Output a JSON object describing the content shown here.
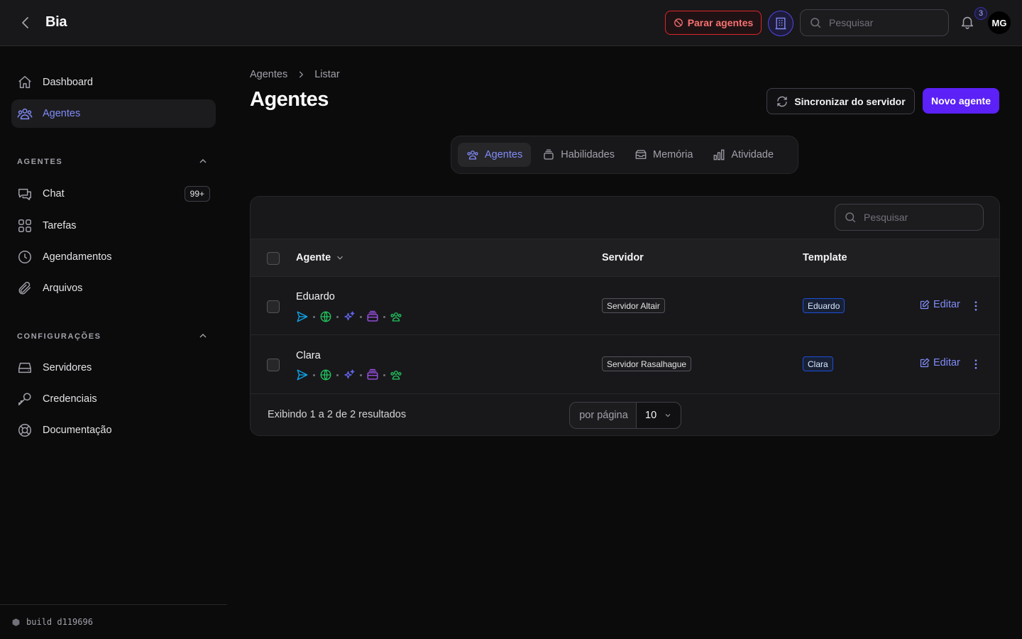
{
  "header": {
    "app_title": "Bia",
    "stop_agents_label": "Parar agentes",
    "search_placeholder": "Pesquisar",
    "notification_count": "3",
    "avatar_initials": "MG"
  },
  "sidebar": {
    "top_items": [
      {
        "label": "Dashboard",
        "icon": "home-icon"
      },
      {
        "label": "Agentes",
        "icon": "users-icon",
        "active": true
      }
    ],
    "sections": [
      {
        "title": "AGENTES",
        "items": [
          {
            "label": "Chat",
            "icon": "chat-icon",
            "badge": "99+"
          },
          {
            "label": "Tarefas",
            "icon": "grid-icon"
          },
          {
            "label": "Agendamentos",
            "icon": "clock-icon"
          },
          {
            "label": "Arquivos",
            "icon": "paperclip-icon"
          }
        ]
      },
      {
        "title": "CONFIGURAÇÕES",
        "items": [
          {
            "label": "Servidores",
            "icon": "server-icon"
          },
          {
            "label": "Credenciais",
            "icon": "key-icon"
          },
          {
            "label": "Documentação",
            "icon": "lifebuoy-icon"
          }
        ]
      }
    ],
    "build": "build d119696"
  },
  "main": {
    "breadcrumb": [
      "Agentes",
      "Listar"
    ],
    "title": "Agentes",
    "sync_label": "Sincronizar do servidor",
    "new_label": "Novo agente",
    "tabs": [
      {
        "label": "Agentes",
        "icon": "users-icon",
        "active": true
      },
      {
        "label": "Habilidades",
        "icon": "stack-icon"
      },
      {
        "label": "Memória",
        "icon": "archive-icon"
      },
      {
        "label": "Atividade",
        "icon": "bar-chart-icon"
      }
    ],
    "table": {
      "search_placeholder": "Pesquisar",
      "columns": [
        "Agente",
        "Servidor",
        "Template"
      ],
      "rows": [
        {
          "name": "Eduardo",
          "server": "Servidor Altair",
          "template": "Eduardo",
          "edit": "Editar"
        },
        {
          "name": "Clara",
          "server": "Servidor Rasalhague",
          "template": "Clara",
          "edit": "Editar"
        }
      ],
      "summary": "Exibindo 1 a 2 de 2 resultados",
      "per_page_label": "por página",
      "per_page_value": "10"
    }
  },
  "colors": {
    "accent": "#818cf8",
    "primary_button": "#5b21f6",
    "danger": "#dc2626",
    "send_icon": "#0ea5e9",
    "globe_icon": "#22c55e",
    "sparkles_icon": "#6366f1",
    "box_icon": "#a855f7",
    "group_icon": "#22c55e"
  }
}
